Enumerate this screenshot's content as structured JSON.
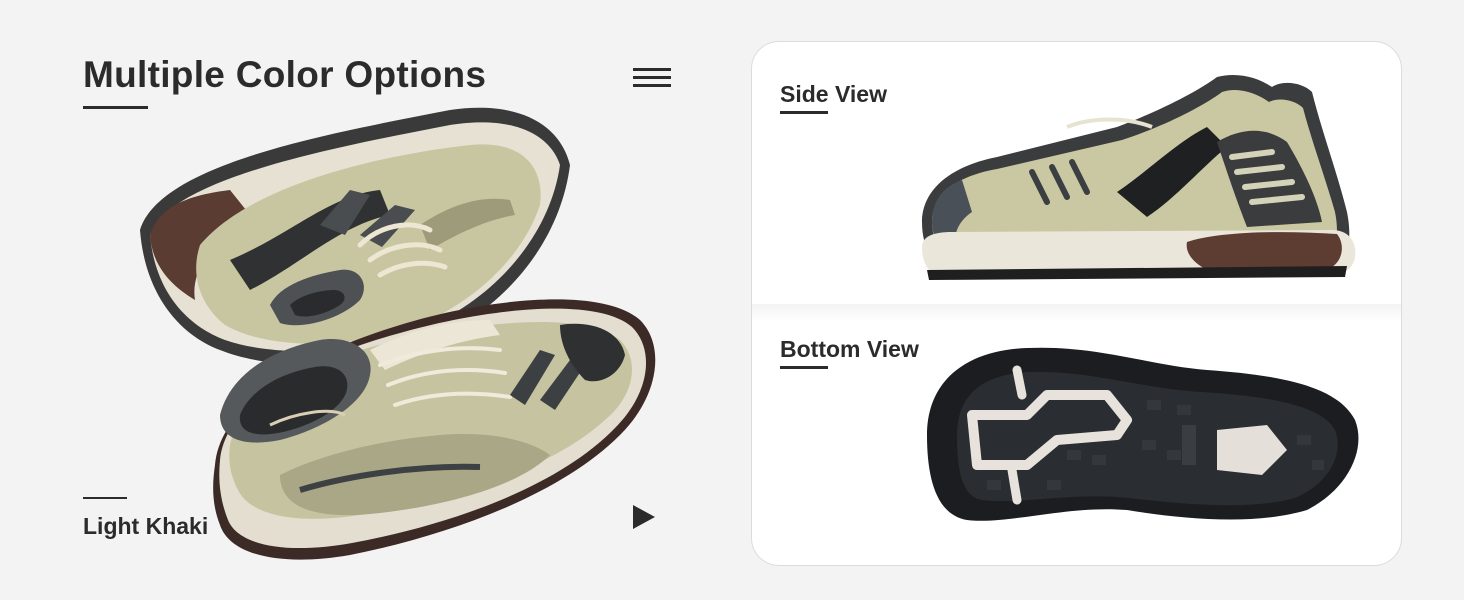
{
  "header": {
    "title": "Multiple Color Options"
  },
  "variant": {
    "label": "Light Khaki"
  },
  "views": {
    "side_label": "Side View",
    "bottom_label": "Bottom View"
  },
  "icons": {
    "menu": "hamburger-menu-icon",
    "next": "play-triangle-icon"
  },
  "colors": {
    "background": "#f3f3f3",
    "text": "#2b2b2b",
    "card": "#ffffff",
    "shoe_khaki": "#c9c7a4",
    "shoe_olive": "#b8b98a",
    "shoe_charcoal": "#555a5c",
    "sole_cream": "#ece7dc",
    "sole_brown": "#5a3a30",
    "outsole_black": "#1e1e1e"
  }
}
